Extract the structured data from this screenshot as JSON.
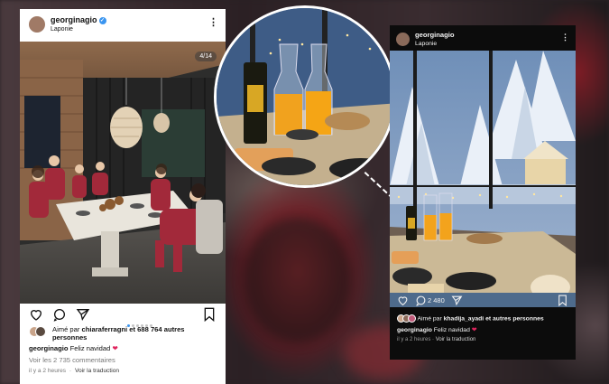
{
  "left_post": {
    "username": "georginagio",
    "location": "Laponie",
    "verified": true,
    "image_counter": "4/14",
    "liked_by_prefix": "Aimé par",
    "liked_by_user": "chiaraferragni",
    "liked_by_rest": "et 688 764 autres personnes",
    "caption_user": "georginagio",
    "caption_text": "Feliz navidad",
    "comments_link": "Voir les 2 735 commentaires",
    "time_ago": "il y a 2 heures",
    "translate_link": "Voir la traduction",
    "carousel_dots": 6,
    "active_dot": 0
  },
  "right_post": {
    "username": "georginagio",
    "location": "Laponie",
    "comment_count": "2 480",
    "liked_by_prefix": "Aimé par",
    "liked_by_user": "khadija_ayadi",
    "liked_by_rest": "et autres personnes",
    "caption_user": "georginagio",
    "caption_text": "Feliz navidad",
    "time_ago": "il y a 2 heures",
    "translate_link": "Voir la traduction"
  },
  "colors": {
    "verified_blue": "#3a95f0",
    "heart_red": "#e0245e",
    "highlight_border": "#ffffff"
  }
}
